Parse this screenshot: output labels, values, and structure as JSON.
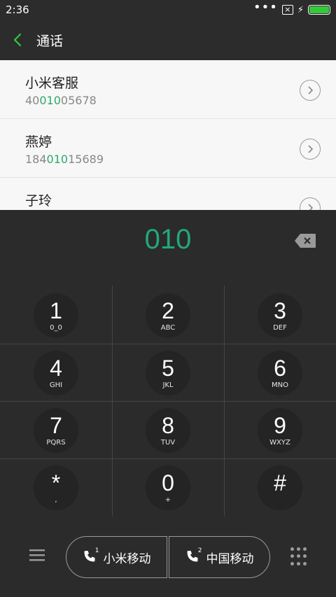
{
  "status": {
    "time": "2:36"
  },
  "header": {
    "title": "通话"
  },
  "results": [
    {
      "name": "小米客服",
      "pre": "40",
      "match": "010",
      "post": "05678"
    },
    {
      "name": "燕婷",
      "pre": "184",
      "match": "010",
      "post": "15689"
    },
    {
      "name": "子玲",
      "pre": "",
      "match": "",
      "post": ""
    }
  ],
  "dialer": {
    "input": "010"
  },
  "keys": [
    {
      "digit": "1",
      "letters": "0_0"
    },
    {
      "digit": "2",
      "letters": "ABC"
    },
    {
      "digit": "3",
      "letters": "DEF"
    },
    {
      "digit": "4",
      "letters": "GHI"
    },
    {
      "digit": "5",
      "letters": "JKL"
    },
    {
      "digit": "6",
      "letters": "MNO"
    },
    {
      "digit": "7",
      "letters": "PQRS"
    },
    {
      "digit": "8",
      "letters": "TUV"
    },
    {
      "digit": "9",
      "letters": "WXYZ"
    },
    {
      "digit": "*",
      "letters": ","
    },
    {
      "digit": "0",
      "letters": "+"
    },
    {
      "digit": "#",
      "letters": ""
    }
  ],
  "call": {
    "sim1_label": "小米移动",
    "sim2_label": "中国移动",
    "sim1_num": "1",
    "sim2_num": "2"
  },
  "colors": {
    "accent": "#21a978",
    "battery": "#35c83c",
    "back_arrow": "#35c83c"
  },
  "icons": [
    "back-arrow-icon",
    "chevron-right-icon",
    "backspace-icon",
    "menu-icon",
    "phone-icon",
    "dialpad-icon"
  ]
}
